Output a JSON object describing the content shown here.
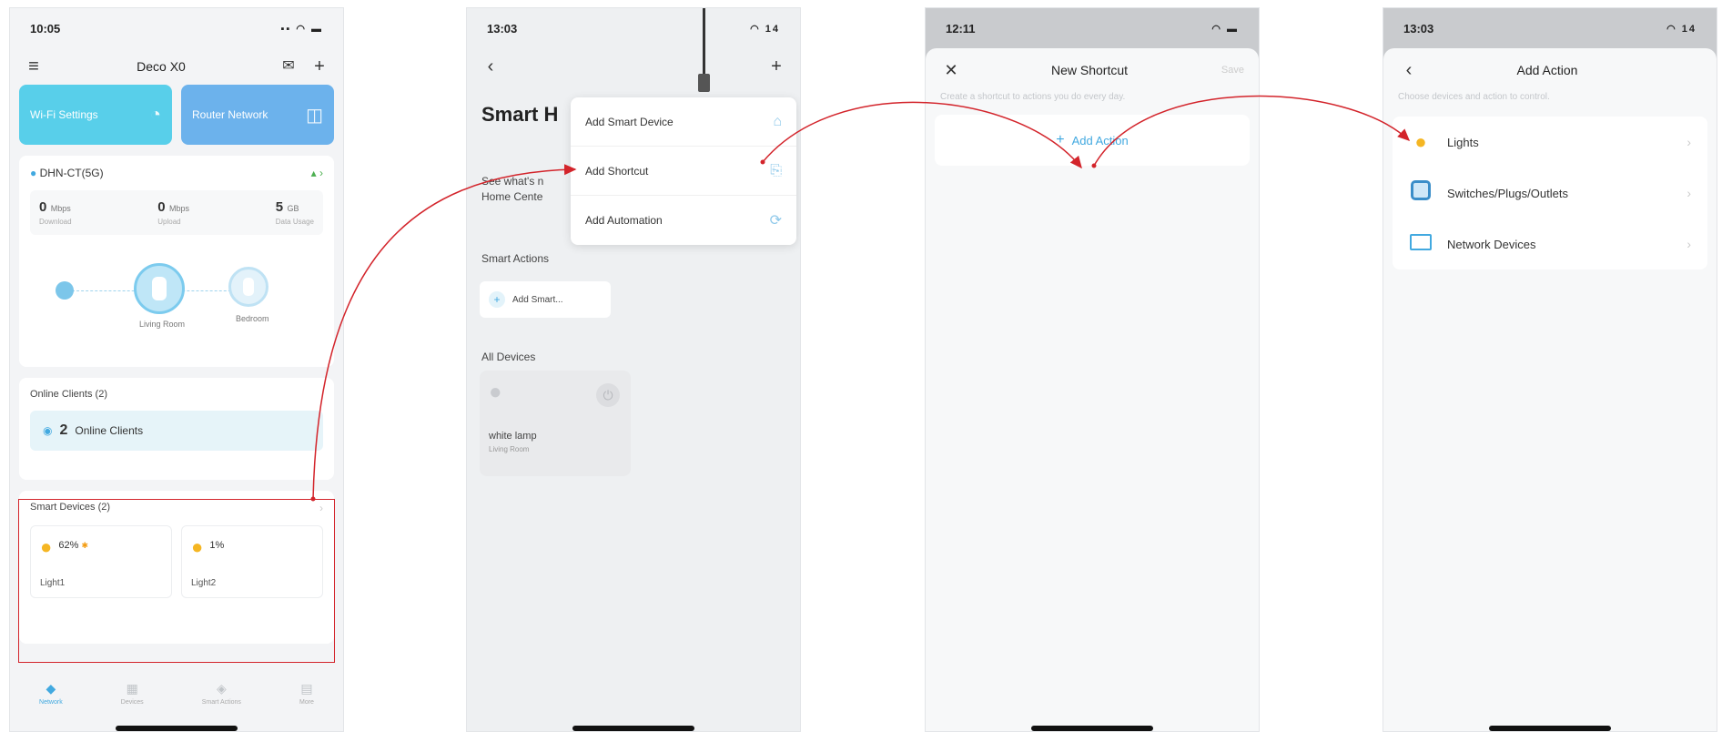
{
  "screen1": {
    "status_time": "10:05",
    "status_icons": "▪▪ ◠ ▬",
    "nav_title": "Deco X0",
    "tile_left": "Wi-Fi Settings",
    "tile_right": "Router Network",
    "network_name": "DHN-CT(5G)",
    "stats": [
      {
        "num": "0",
        "unit": "Mbps",
        "label": "Download"
      },
      {
        "num": "0",
        "unit": "Mbps",
        "label": "Upload"
      },
      {
        "num": "5",
        "unit": "GB",
        "label": "Data Usage"
      }
    ],
    "node_main_label": "Living Room",
    "node_sat_label": "Bedroom",
    "online_clients_title": "Online Clients (2)",
    "online_clients_count": "2",
    "online_clients_text": "Online Clients",
    "smart_devices_title": "Smart Devices (2)",
    "devices": [
      {
        "pct": "62%",
        "name": "Light1"
      },
      {
        "pct": "1%",
        "name": "Light2"
      }
    ],
    "tabs": [
      "Network",
      "Devices",
      "Smart Actions",
      "More"
    ]
  },
  "screen2": {
    "status_time": "13:03",
    "status_icons": "◠ 14",
    "title": "Smart H",
    "subtitle_line1": "See what's n",
    "subtitle_line2": "Home Cente",
    "smart_actions_heading": "Smart Actions",
    "add_smart_label": "Add Smart...",
    "all_devices_heading": "All Devices",
    "lamp_name": "white lamp",
    "lamp_room": "Living Room",
    "menu": [
      "Add Smart Device",
      "Add Shortcut",
      "Add Automation"
    ]
  },
  "screen3": {
    "status_time": "12:11",
    "status_icons": "◠ ▬",
    "title": "New Shortcut",
    "save_label": "Save",
    "hint": "Create a shortcut to actions you do every day.",
    "add_action_label": "Add Action"
  },
  "screen4": {
    "status_time": "13:03",
    "status_icons": "◠ 14",
    "title": "Add Action",
    "hint": "Choose devices and action to control.",
    "items": [
      "Lights",
      "Switches/Plugs/Outlets",
      "Network Devices"
    ]
  },
  "colors": {
    "accent": "#42a9e0",
    "highlight": "#d3242b",
    "bulb": "#f5b623"
  }
}
